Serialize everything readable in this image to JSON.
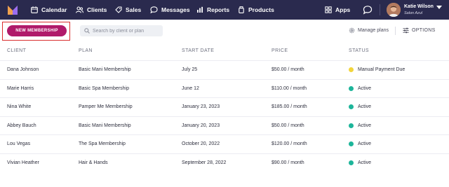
{
  "nav": {
    "items": [
      {
        "label": "Calendar",
        "icon": "calendar-icon"
      },
      {
        "label": "Clients",
        "icon": "clients-icon"
      },
      {
        "label": "Sales",
        "icon": "tag-icon"
      },
      {
        "label": "Messages",
        "icon": "messages-icon"
      },
      {
        "label": "Reports",
        "icon": "bar-chart-icon"
      },
      {
        "label": "Products",
        "icon": "products-icon"
      }
    ],
    "apps_label": "Apps",
    "user": {
      "name": "Katie Wilson",
      "location": "Salon Azul"
    }
  },
  "toolbar": {
    "new_label": "NEW MEMBERSHIP",
    "search_placeholder": "Search by client or plan",
    "manage_label": "Manage plans",
    "options_label": "OPTIONS"
  },
  "table": {
    "headers": {
      "client": "CLIENT",
      "plan": "PLAN",
      "start": "START DATE",
      "price": "PRICE",
      "status": "STATUS"
    },
    "rows": [
      {
        "client": "Dana Johnson",
        "plan": "Basic Mani Membership",
        "start": "July 25",
        "price": "$50.00 / month",
        "status": "Manual Payment Due",
        "status_color": "#f2d53c"
      },
      {
        "client": "Marie Harris",
        "plan": "Basic Spa Membership",
        "start": "June 12",
        "price": "$110.00 / month",
        "status": "Active",
        "status_color": "#1db59a"
      },
      {
        "client": "Nina White",
        "plan": "Pamper Me Membership",
        "start": "January 23, 2023",
        "price": "$185.00 / month",
        "status": "Active",
        "status_color": "#1db59a"
      },
      {
        "client": "Abbey Bauch",
        "plan": "Basic Mani Membership",
        "start": "January 20, 2023",
        "price": "$50.00 / month",
        "status": "Active",
        "status_color": "#1db59a"
      },
      {
        "client": "Lou Vegas",
        "plan": "The Spa Membership",
        "start": "October 20, 2022",
        "price": "$120.00 / month",
        "status": "Active",
        "status_color": "#1db59a"
      },
      {
        "client": "Vivian Heather",
        "plan": "Hair & Hands",
        "start": "September 28, 2022",
        "price": "$90.00 / month",
        "status": "Active",
        "status_color": "#1db59a"
      }
    ]
  },
  "colors": {
    "nav_bg": "#2a2a4e",
    "accent": "#b01a6a",
    "highlight": "#d92d2d"
  }
}
